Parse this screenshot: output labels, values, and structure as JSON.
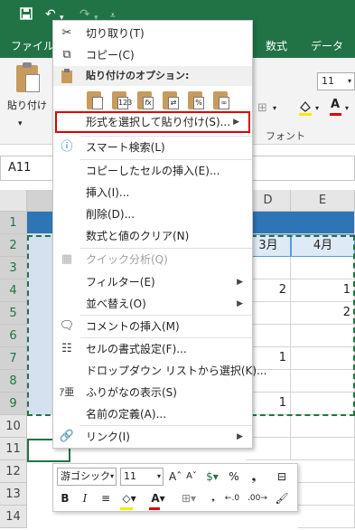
{
  "titlebar": {
    "qat": [
      "save-icon",
      "undo-icon",
      "redo-icon",
      "customize-qat-icon"
    ]
  },
  "tabs": {
    "file": "ファイル",
    "formulas": "数式",
    "data": "データ"
  },
  "ribbon": {
    "paste_label": "貼り付け",
    "font_group_label": "フォント",
    "font_size": "11"
  },
  "formula_bar": {
    "name_box": "A11"
  },
  "columns": [
    "D",
    "E"
  ],
  "rows": [
    "1",
    "2",
    "3",
    "4",
    "5",
    "6",
    "7",
    "8",
    "9",
    "10",
    "11",
    "12",
    "13",
    "14"
  ],
  "cells": {
    "d2": "3月",
    "e2": "4月",
    "d4": "2",
    "e4": "1",
    "e5": "2",
    "d7": "1",
    "d9": "1"
  },
  "context_menu": {
    "cut": "切り取り(T)",
    "copy": "コピー(C)",
    "paste_options_header": "貼り付けのオプション:",
    "paste_special": "形式を選択して貼り付け(S)...",
    "smart_lookup": "スマート検索(L)",
    "insert_copied": "コピーしたセルの挿入(E)...",
    "insert": "挿入(I)...",
    "delete": "削除(D)...",
    "clear_contents": "数式と値のクリア(N)",
    "quick_analysis": "クイック分析(Q)",
    "filter": "フィルター(E)",
    "sort": "並べ替え(O)",
    "insert_comment": "コメントの挿入(M)",
    "format_cells": "セルの書式設定(F)...",
    "pick_from_list": "ドロップダウン リストから選択(K)...",
    "show_phonetic": "ふりがなの表示(S)",
    "define_name": "名前の定義(A)...",
    "link": "リンク(I)"
  },
  "mini_toolbar": {
    "font": "游ゴシック",
    "size": "11"
  },
  "colors": {
    "excel_green": "#217346",
    "header_blue": "#2e75b6",
    "light_blue": "#deeaf6",
    "highlight_red": "#e00000"
  }
}
